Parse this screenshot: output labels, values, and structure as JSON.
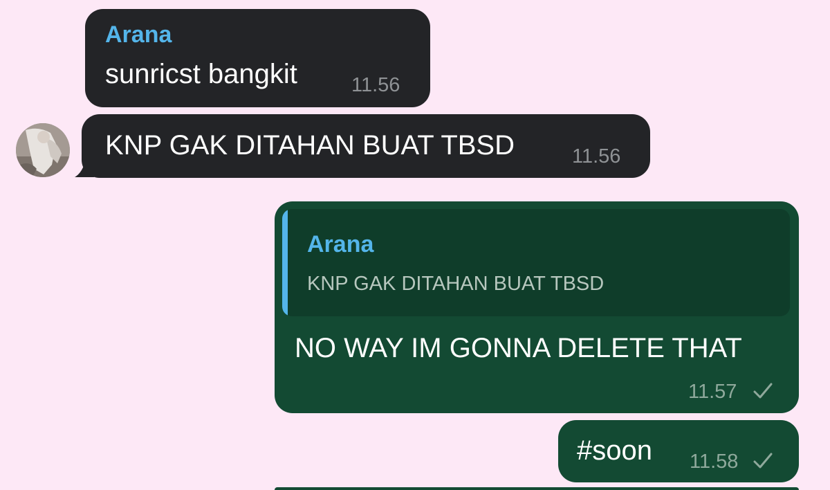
{
  "messages": [
    {
      "direction": "incoming",
      "sender": "Arana",
      "text": "sunricst bangkit",
      "time": "11.56"
    },
    {
      "direction": "incoming",
      "text": "KNP GAK DITAHAN BUAT TBSD",
      "time": "11.56"
    },
    {
      "direction": "outgoing",
      "reply": {
        "sender": "Arana",
        "text": "KNP GAK DITAHAN BUAT TBSD"
      },
      "text": "NO WAY IM GONNA DELETE THAT",
      "time": "11.57",
      "status": "sent"
    },
    {
      "direction": "outgoing",
      "text": "#soon",
      "time": "11.58",
      "status": "sent"
    }
  ],
  "colors": {
    "background": "#fde8f6",
    "incoming_bubble": "#232427",
    "outgoing_bubble": "#134a33",
    "sender_name": "#54b5ea",
    "timestamp": "#8f9295"
  },
  "icons": {
    "sent_status": "check-icon",
    "avatar": "user-avatar-photo"
  }
}
